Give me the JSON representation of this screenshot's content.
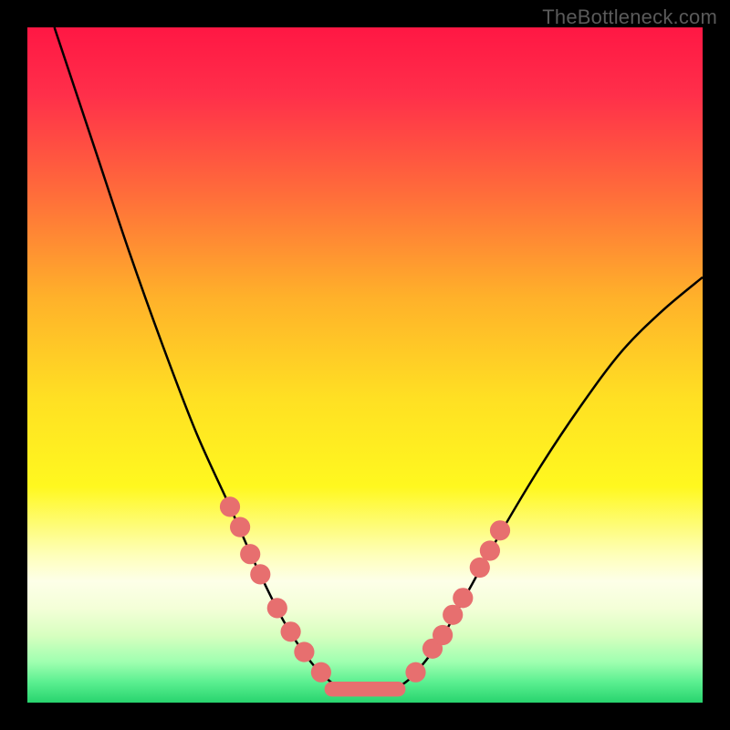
{
  "watermark": "TheBottleneck.com",
  "chart_data": {
    "type": "line",
    "title": "",
    "xlabel": "",
    "ylabel": "",
    "xlim": [
      0,
      100
    ],
    "ylim": [
      0,
      100
    ],
    "gradient_stops": [
      {
        "offset": 0,
        "color": "#ff1744"
      },
      {
        "offset": 0.1,
        "color": "#ff2f4a"
      },
      {
        "offset": 0.25,
        "color": "#ff6e3a"
      },
      {
        "offset": 0.4,
        "color": "#ffb12a"
      },
      {
        "offset": 0.55,
        "color": "#ffe023"
      },
      {
        "offset": 0.68,
        "color": "#fff81f"
      },
      {
        "offset": 0.78,
        "color": "#feffb8"
      },
      {
        "offset": 0.82,
        "color": "#fdffe8"
      },
      {
        "offset": 0.86,
        "color": "#f4ffd8"
      },
      {
        "offset": 0.9,
        "color": "#d8ffc0"
      },
      {
        "offset": 0.94,
        "color": "#9fffb0"
      },
      {
        "offset": 0.97,
        "color": "#5aef90"
      },
      {
        "offset": 1.0,
        "color": "#28d46e"
      }
    ],
    "curve": [
      {
        "x": 4,
        "y": 100
      },
      {
        "x": 6,
        "y": 94
      },
      {
        "x": 10,
        "y": 82
      },
      {
        "x": 15,
        "y": 67
      },
      {
        "x": 20,
        "y": 53
      },
      {
        "x": 25,
        "y": 40
      },
      {
        "x": 30,
        "y": 29
      },
      {
        "x": 34,
        "y": 20
      },
      {
        "x": 38,
        "y": 12
      },
      {
        "x": 42,
        "y": 6
      },
      {
        "x": 45,
        "y": 3
      },
      {
        "x": 47,
        "y": 2
      },
      {
        "x": 49,
        "y": 2
      },
      {
        "x": 52,
        "y": 2
      },
      {
        "x": 54,
        "y": 2
      },
      {
        "x": 56,
        "y": 3
      },
      {
        "x": 58,
        "y": 5
      },
      {
        "x": 61,
        "y": 9
      },
      {
        "x": 65,
        "y": 16
      },
      {
        "x": 70,
        "y": 25
      },
      {
        "x": 76,
        "y": 35
      },
      {
        "x": 82,
        "y": 44
      },
      {
        "x": 88,
        "y": 52
      },
      {
        "x": 94,
        "y": 58
      },
      {
        "x": 100,
        "y": 63
      }
    ],
    "markers_left": [
      {
        "x": 30,
        "y": 29
      },
      {
        "x": 31.5,
        "y": 26
      },
      {
        "x": 33,
        "y": 22
      },
      {
        "x": 34.5,
        "y": 19
      },
      {
        "x": 37,
        "y": 14
      },
      {
        "x": 39,
        "y": 10.5
      },
      {
        "x": 41,
        "y": 7.5
      },
      {
        "x": 43.5,
        "y": 4.5
      }
    ],
    "markers_right": [
      {
        "x": 57.5,
        "y": 4.5
      },
      {
        "x": 60,
        "y": 8
      },
      {
        "x": 61.5,
        "y": 10
      },
      {
        "x": 63,
        "y": 13
      },
      {
        "x": 64.5,
        "y": 15.5
      },
      {
        "x": 67,
        "y": 20
      },
      {
        "x": 68.5,
        "y": 22.5
      },
      {
        "x": 70,
        "y": 25.5
      }
    ],
    "bottom_bar": {
      "x0": 44,
      "x1": 56,
      "y": 2,
      "thickness": 2.2
    },
    "marker_color": "#e76f6f",
    "marker_radius": 1.5,
    "curve_color": "#000000",
    "curve_width": 0.35
  }
}
